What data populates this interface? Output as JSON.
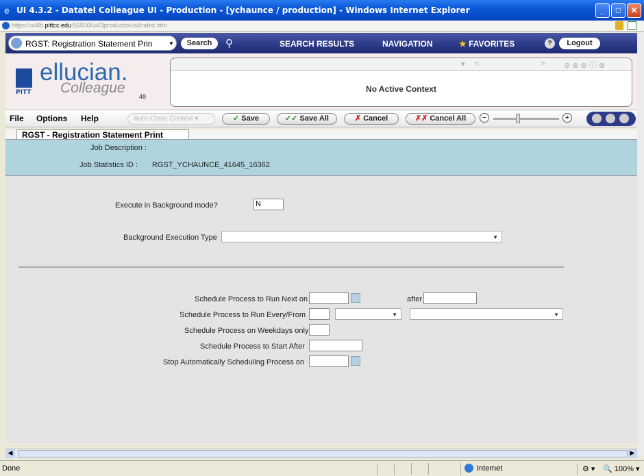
{
  "window": {
    "title": "UI 4.3.2 - Datatel Colleague UI - Production - [ychaunce / production] - Windows Internet Explorer",
    "url_prefix": "https://ui4lb.",
    "url_domain": "pittcc.edu",
    "url_suffix": ":56500/ui43production/sl/index.htm"
  },
  "toolbar": {
    "form_select": "RGST: Registration Statement Prin",
    "search_label": "Search",
    "search_results": "SEARCH RESULTS",
    "navigation": "NAVIGATION",
    "favorites": "FAVORITES",
    "help": "?",
    "logout": "Logout"
  },
  "header": {
    "brand": "ellucian.",
    "product": "Colleague",
    "release": "48",
    "institution": "PITT",
    "context_text": "No Active Context"
  },
  "menubar": {
    "file": "File",
    "options": "Options",
    "help": "Help",
    "auto_close": "Auto-Close Context",
    "save": "Save",
    "save_all": "Save All",
    "cancel": "Cancel",
    "cancel_all": "Cancel All"
  },
  "form": {
    "tab_title": "RGST - Registration Statement Print",
    "job_description_label": "Job Description :",
    "job_stats_label": "Job Statistics ID :",
    "job_stats_value": "RGST_YCHAUNCE_41645_16362",
    "bg_mode_label": "Execute in Background mode?",
    "bg_mode_value": "N",
    "bg_type_label": "Background Execution Type",
    "bg_type_value": "",
    "run_next_label": "Schedule Process to Run Next on",
    "after_label": "after",
    "run_every_label": "Schedule Process to Run Every/From",
    "weekdays_label": "Schedule Process on Weekdays only",
    "start_after_label": "Schedule Process to Start After",
    "stop_label": "Stop Automatically Scheduling Process on"
  },
  "statusbar": {
    "status": "Done",
    "zone": "Internet",
    "zoom": "100%"
  }
}
